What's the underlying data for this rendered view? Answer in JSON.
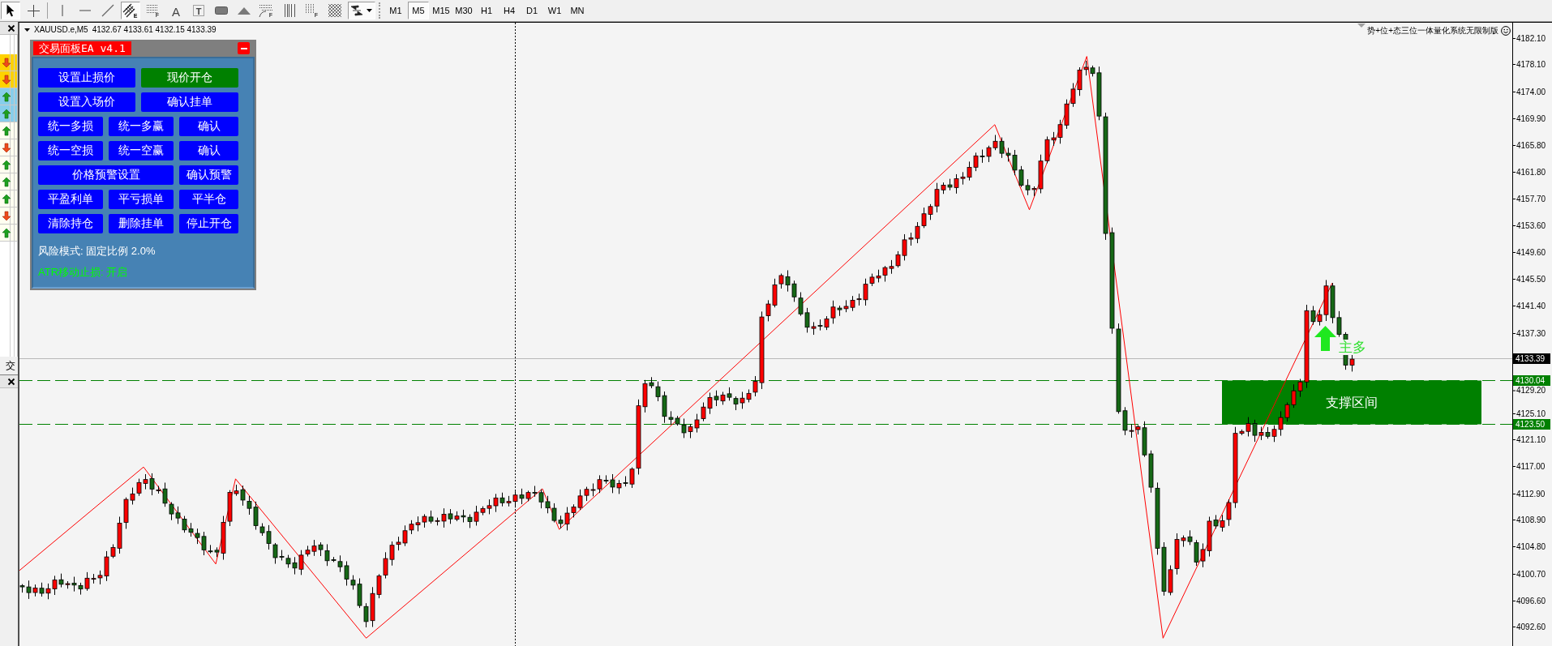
{
  "toolbar": {
    "tools": [
      {
        "kind": "cursor",
        "selected": true
      },
      {
        "kind": "crosshair",
        "selected": false
      },
      {
        "kind": "vline",
        "selected": false
      },
      {
        "kind": "hline",
        "selected": false
      },
      {
        "kind": "trendline",
        "selected": false
      },
      {
        "kind": "channel",
        "letter": "E",
        "selected": true
      },
      {
        "kind": "fibo",
        "letter": "F",
        "selected": false
      },
      {
        "kind": "text",
        "letter": "A",
        "selected": false
      },
      {
        "kind": "label",
        "letter": "T",
        "selected": false
      },
      {
        "kind": "rectangle",
        "selected": false
      },
      {
        "kind": "triangle",
        "selected": false
      },
      {
        "kind": "fan",
        "letter": "F",
        "selected": false
      },
      {
        "kind": "timezones",
        "selected": false
      },
      {
        "kind": "fibo_channel",
        "letter": "F",
        "selected": false
      },
      {
        "kind": "grid",
        "selected": false
      },
      {
        "kind": "arrows",
        "selected": true
      }
    ],
    "periods": [
      {
        "label": "M1",
        "selected": false
      },
      {
        "label": "M5",
        "selected": true
      },
      {
        "label": "M15",
        "selected": false
      },
      {
        "label": "M30",
        "selected": false
      },
      {
        "label": "H1",
        "selected": false
      },
      {
        "label": "H4",
        "selected": false
      },
      {
        "label": "D1",
        "selected": false
      },
      {
        "label": "W1",
        "selected": false
      },
      {
        "label": "MN",
        "selected": false
      }
    ]
  },
  "side_panel": {
    "rows": [
      {
        "color": "#ffd200",
        "kind": "down"
      },
      {
        "color": "#ffd200",
        "kind": "down"
      },
      {
        "color": "#87ceeb",
        "kind": "up"
      },
      {
        "color": "#87ceeb",
        "kind": "up"
      },
      {
        "color": "#fffff0",
        "kind": "up"
      },
      {
        "color": "#fffff0",
        "kind": "down"
      },
      {
        "color": "#fffff0",
        "kind": "up"
      },
      {
        "color": "#fffff0",
        "kind": "up"
      },
      {
        "color": "#fffff0",
        "kind": "up"
      },
      {
        "color": "#fffff0",
        "kind": "down"
      },
      {
        "color": "#fffff0",
        "kind": "up"
      }
    ],
    "tab": "交"
  },
  "chart": {
    "symbol": "XAUUSD.e,M5",
    "quote": "4132.67 4133.61 4132.15 4133.39",
    "banner": "势+位+态三位一体量化系统无限制版",
    "ea_panel": {
      "title": "交易面板EA v4.1",
      "button_rows": [
        {
          "kind": "halves",
          "buttons": [
            {
              "label": "设置止损价",
              "color": "#0000ff"
            },
            {
              "label": "现价开仓",
              "color": "#008000"
            }
          ]
        },
        {
          "kind": "halves",
          "buttons": [
            {
              "label": "设置入场价",
              "color": "#0000ff"
            },
            {
              "label": "确认挂单",
              "color": "#0000ff"
            }
          ]
        },
        {
          "kind": "thirds",
          "buttons": [
            {
              "label": "统一多损",
              "color": "#0000ff"
            },
            {
              "label": "统一多赢",
              "color": "#0000ff"
            },
            {
              "label": "确认",
              "color": "#0000ff"
            }
          ]
        },
        {
          "kind": "thirds",
          "buttons": [
            {
              "label": "统一空损",
              "color": "#0000ff"
            },
            {
              "label": "统一空赢",
              "color": "#0000ff"
            },
            {
              "label": "确认",
              "color": "#0000ff"
            }
          ]
        },
        {
          "kind": "wide",
          "buttons": [
            {
              "label": "价格预警设置",
              "color": "#0000ff"
            },
            {
              "label": "确认预警",
              "color": "#0000ff"
            }
          ]
        },
        {
          "kind": "thirds",
          "buttons": [
            {
              "label": "平盈利单",
              "color": "#0000ff"
            },
            {
              "label": "平亏损单",
              "color": "#0000ff"
            },
            {
              "label": "平半仓",
              "color": "#0000ff"
            }
          ]
        },
        {
          "kind": "thirds",
          "buttons": [
            {
              "label": "清除持仓",
              "color": "#0000ff"
            },
            {
              "label": "删除挂单",
              "color": "#0000ff"
            },
            {
              "label": "停止开仓",
              "color": "#0000ff"
            }
          ]
        }
      ],
      "info": [
        {
          "text": "风险模式: 固定比例 2.0%",
          "color": "#ffffff"
        },
        {
          "text": "ATR移动止损: 开启",
          "color": "#00ff00"
        }
      ]
    },
    "signal": {
      "label": "主多"
    },
    "support_zone": {
      "label": "支撑区间"
    },
    "price_axis": {
      "ticks": [
        "4182.10",
        "4178.10",
        "4174.00",
        "4169.90",
        "4165.80",
        "4161.80",
        "4157.70",
        "4153.60",
        "4149.60",
        "4145.50",
        "4141.40",
        "4137.30",
        "4129.20",
        "4125.10",
        "4121.10",
        "4117.00",
        "4112.90",
        "4108.90",
        "4104.80",
        "4100.70",
        "4096.60",
        "4092.60"
      ],
      "markers": [
        {
          "label": "4133.39",
          "kind": "bid",
          "color": "#000000"
        },
        {
          "label": "4130.04",
          "kind": "level",
          "color": "#008000"
        },
        {
          "label": "4123.50",
          "kind": "level",
          "color": "#008000"
        }
      ]
    }
  }
}
